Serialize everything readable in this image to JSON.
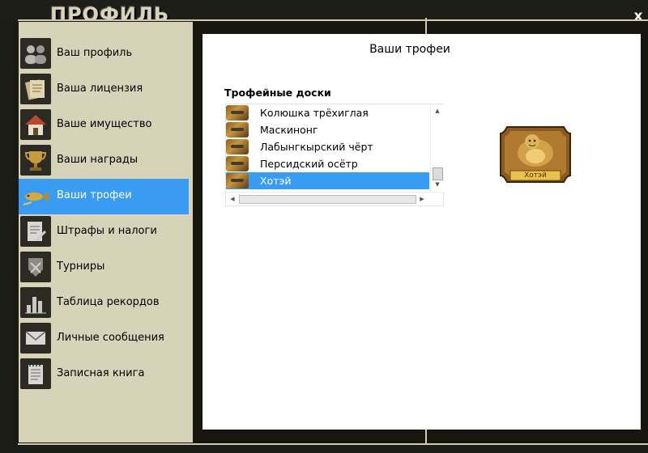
{
  "window": {
    "title": "ПРОФИЛЬ",
    "close_glyph": "x"
  },
  "sidebar": {
    "items": [
      {
        "label": "Ваш профиль",
        "icon": "users-icon"
      },
      {
        "label": "Ваша лицензия",
        "icon": "documents-icon"
      },
      {
        "label": "Ваше имущество",
        "icon": "house-icon"
      },
      {
        "label": "Ваши награды",
        "icon": "cup-icon"
      },
      {
        "label": "Ваши трофеи",
        "icon": "fish-icon",
        "active": true
      },
      {
        "label": "Штрафы и налоги",
        "icon": "fines-icon"
      },
      {
        "label": "Турниры",
        "icon": "tournament-icon"
      },
      {
        "label": "Таблица рекордов",
        "icon": "records-icon"
      },
      {
        "label": "Личные сообщения",
        "icon": "envelope-icon"
      },
      {
        "label": "Записная книга",
        "icon": "notebook-icon"
      }
    ],
    "active_color": "#3a9bf2"
  },
  "content": {
    "title": "Ваши трофеи",
    "section_label": "Трофейные доски",
    "trophies": [
      {
        "label": "Колюшка трёхиглая"
      },
      {
        "label": "Маскинонг"
      },
      {
        "label": "Лабынгкырский чёрт"
      },
      {
        "label": "Персидский осётр"
      },
      {
        "label": "Хотэй",
        "selected": true
      }
    ],
    "preview_caption": "Хотэй"
  }
}
